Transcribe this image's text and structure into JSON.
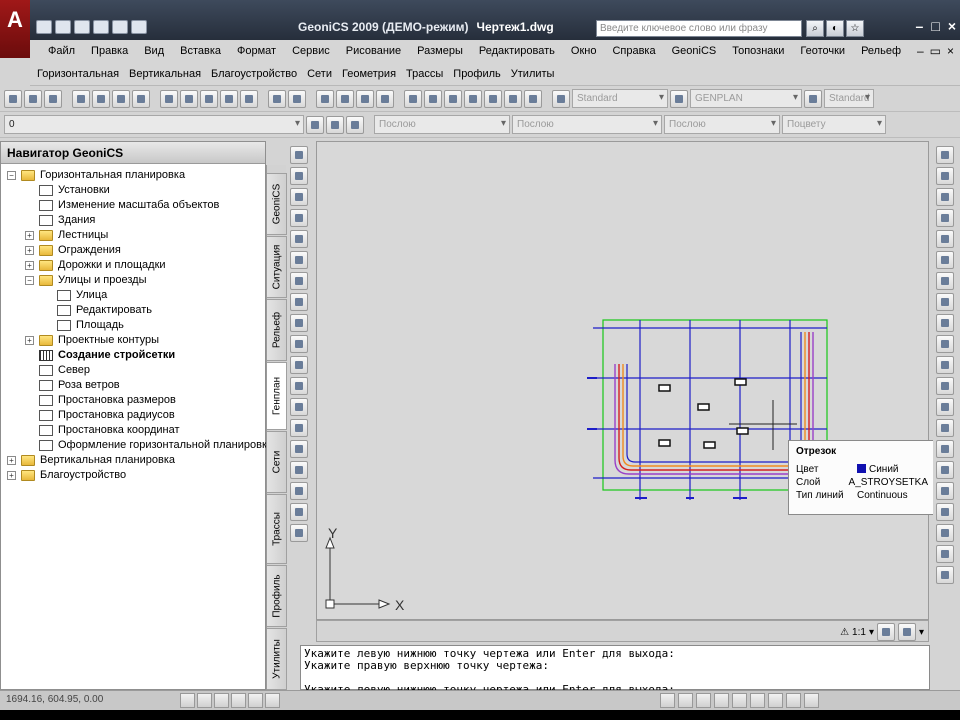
{
  "app": {
    "title": "GeoniCS 2009 (ДЕМО-режим)",
    "document": "Чертеж1.dwg",
    "logo_letter": "A"
  },
  "search": {
    "placeholder": "Введите ключевое слово или фразу"
  },
  "menu1": [
    "Файл",
    "Правка",
    "Вид",
    "Вставка",
    "Формат",
    "Сервис",
    "Рисование",
    "Размеры",
    "Редактировать",
    "Окно",
    "Справка",
    "GeoniCS",
    "Топознаки",
    "Геоточки",
    "Рельеф"
  ],
  "menu2": [
    "Горизонтальная",
    "Вертикальная",
    "Благоустройство",
    "Сети",
    "Геометрия",
    "Трассы",
    "Профиль",
    "Утилиты"
  ],
  "toolbar": {
    "text_style": "Standard",
    "dim_style": "GENPLAN",
    "table_style": "Standard",
    "layer_value": "0",
    "color": "Послою",
    "linetype": "Послою",
    "lineweight": "Послою",
    "plotstyle": "Поцвету"
  },
  "navigator": {
    "title": "Навигатор GeoniCS",
    "items": [
      {
        "label": "Горизонтальная планировка",
        "level": 0,
        "exp": "−",
        "icon": "folder",
        "bold": false
      },
      {
        "label": "Установки",
        "level": 1,
        "exp": "",
        "icon": "tool",
        "bold": false
      },
      {
        "label": "Изменение масштаба объектов",
        "level": 1,
        "exp": "",
        "icon": "tool",
        "bold": false
      },
      {
        "label": "Здания",
        "level": 1,
        "exp": "",
        "icon": "tool",
        "bold": false
      },
      {
        "label": "Лестницы",
        "level": 1,
        "exp": "+",
        "icon": "folder",
        "bold": false
      },
      {
        "label": "Ограждения",
        "level": 1,
        "exp": "+",
        "icon": "folder",
        "bold": false
      },
      {
        "label": "Дорожки и площадки",
        "level": 1,
        "exp": "+",
        "icon": "folder",
        "bold": false
      },
      {
        "label": "Улицы и проезды",
        "level": 1,
        "exp": "−",
        "icon": "folder",
        "bold": false
      },
      {
        "label": "Улица",
        "level": 2,
        "exp": "",
        "icon": "tool",
        "bold": false
      },
      {
        "label": "Редактировать",
        "level": 2,
        "exp": "",
        "icon": "tool",
        "bold": false
      },
      {
        "label": "Площадь",
        "level": 2,
        "exp": "",
        "icon": "tool",
        "bold": false
      },
      {
        "label": "Проектные контуры",
        "level": 1,
        "exp": "+",
        "icon": "folder",
        "bold": false
      },
      {
        "label": "Создание стройсетки",
        "level": 1,
        "exp": "",
        "icon": "grid",
        "bold": true
      },
      {
        "label": "Север",
        "level": 1,
        "exp": "",
        "icon": "tool",
        "bold": false
      },
      {
        "label": "Роза ветров",
        "level": 1,
        "exp": "",
        "icon": "tool",
        "bold": false
      },
      {
        "label": "Простановка размеров",
        "level": 1,
        "exp": "",
        "icon": "tool",
        "bold": false
      },
      {
        "label": "Простановка радиусов",
        "level": 1,
        "exp": "",
        "icon": "tool",
        "bold": false
      },
      {
        "label": "Простановка координат",
        "level": 1,
        "exp": "",
        "icon": "tool",
        "bold": false
      },
      {
        "label": "Оформление горизонтальной планировки",
        "level": 1,
        "exp": "",
        "icon": "tool",
        "bold": false
      },
      {
        "label": "Вертикальная планировка",
        "level": 0,
        "exp": "+",
        "icon": "folder",
        "bold": false
      },
      {
        "label": "Благоустройство",
        "level": 0,
        "exp": "+",
        "icon": "folder",
        "bold": false
      }
    ]
  },
  "side_tabs": [
    "GeoniCS",
    "Ситуация",
    "Рельеф",
    "Генплан",
    "Сети",
    "Трассы",
    "Профиль",
    "Утилиты"
  ],
  "tooltip": {
    "title": "Отрезок",
    "rows": [
      {
        "key": "Цвет",
        "value": "Синий"
      },
      {
        "key": "Слой",
        "value": "A_STROYSETKA"
      },
      {
        "key": "Тип линий",
        "value": "Continuous"
      }
    ]
  },
  "ucs": {
    "x": "X",
    "y": "Y"
  },
  "annotation_scale": "1:1",
  "command_lines": [
    "Укажите левую нижнюю точку чертежа или Enter для выхода:",
    "Укажите правую верхнюю точку чертежа:",
    "",
    "Укажите левую нижнюю точку чертежа или Enter для выхода:"
  ],
  "status": {
    "coords": "1694.16, 604.95, 0.00"
  },
  "colors": {
    "grid_blue": "#1d1dc8",
    "frame_green": "#18c818",
    "road_orange": "#f08a20",
    "road_red": "#d42020",
    "road_purple": "#9a40c8"
  }
}
